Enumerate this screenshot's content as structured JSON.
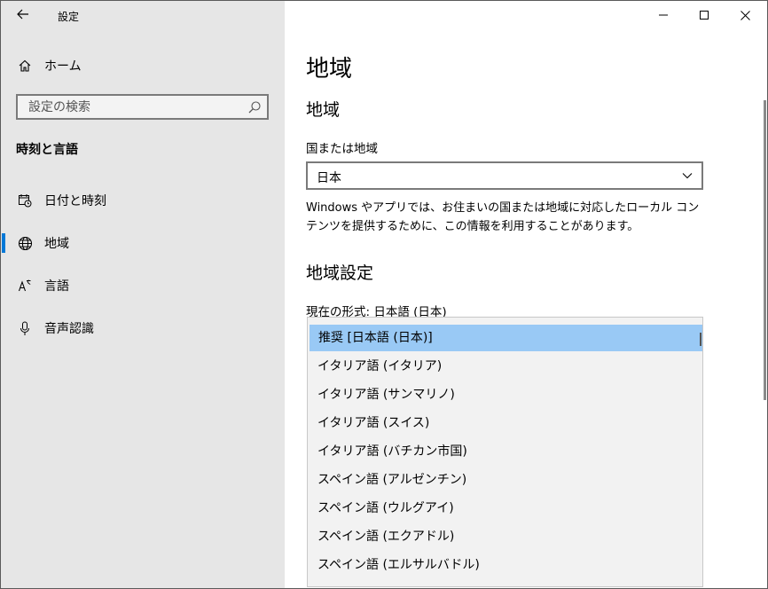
{
  "window": {
    "title": "設定"
  },
  "sidebar": {
    "home_label": "ホーム",
    "search_placeholder": "設定の検索",
    "section": "時刻と言語",
    "items": [
      {
        "label": "日付と時刻",
        "icon": "calendar-clock-icon"
      },
      {
        "label": "地域",
        "icon": "globe-icon",
        "selected": true
      },
      {
        "label": "言語",
        "icon": "language-icon"
      },
      {
        "label": "音声認識",
        "icon": "microphone-icon"
      }
    ]
  },
  "main": {
    "page_title": "地域",
    "region_heading": "地域",
    "country_label": "国または地域",
    "country_value": "日本",
    "description": "Windows やアプリでは、お住まいの国または地域に対応したローカル コンテンツを提供するために、この情報を利用することがあります。",
    "format_heading": "地域設定",
    "current_format_label": "現在の形式: 日本語 (日本)",
    "format_options": [
      "推奨 [日本語 (日本)]",
      "イタリア語 (イタリア)",
      "イタリア語 (サンマリノ)",
      "イタリア語 (スイス)",
      "イタリア語 (バチカン市国)",
      "スペイン語 (アルゼンチン)",
      "スペイン語 (ウルグアイ)",
      "スペイン語 (エクアドル)",
      "スペイン語 (エルサルバドル)"
    ],
    "selected_option_index": 0
  },
  "colors": {
    "sidebar_bg": "#e6e6e6",
    "accent": "#0078d7",
    "selected_item_bg": "#99c9f5",
    "dropdown_bg": "#f2f2f2"
  }
}
